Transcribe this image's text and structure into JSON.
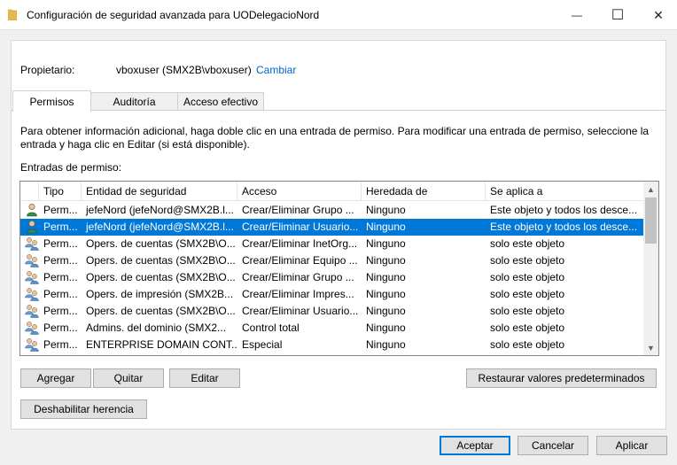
{
  "window": {
    "title": "Configuración de seguridad avanzada para UODelegacioNord",
    "minimize_glyph": "—",
    "maximize_glyph": "☐",
    "close_glyph": "✕",
    "folder_icon_color": "#e8b84a"
  },
  "owner": {
    "label": "Propietario:",
    "value": "vboxuser (SMX2B\\vboxuser)",
    "change_link": "Cambiar"
  },
  "tabs": [
    {
      "label": "Permisos",
      "active": true
    },
    {
      "label": "Auditoría",
      "active": false
    },
    {
      "label": "Acceso efectivo",
      "active": false
    }
  ],
  "info_text": "Para obtener información adicional, haga doble clic en una entrada de permiso. Para modificar una entrada de permiso, seleccione la entrada y haga clic en Editar (si está disponible).",
  "entries_label": "Entradas de permiso:",
  "columns": [
    "Tipo",
    "Entidad de seguridad",
    "Acceso",
    "Heredada de",
    "Se aplica a"
  ],
  "rows": [
    {
      "icon": "user-icon",
      "tipo": "Perm...",
      "entidad": "jefeNord (jefeNord@SMX2B.l...",
      "acceso": "Crear/Eliminar Grupo ...",
      "heredada": "Ninguno",
      "aplica": "Este objeto y todos los desce...",
      "selected": false
    },
    {
      "icon": "user-icon",
      "tipo": "Perm...",
      "entidad": "jefeNord (jefeNord@SMX2B.l...",
      "acceso": "Crear/Eliminar Usuario...",
      "heredada": "Ninguno",
      "aplica": "Este objeto y todos los desce...",
      "selected": true
    },
    {
      "icon": "group-icon",
      "tipo": "Perm...",
      "entidad": "Opers. de cuentas (SMX2B\\O...",
      "acceso": "Crear/Eliminar InetOrg...",
      "heredada": "Ninguno",
      "aplica": "solo este objeto",
      "selected": false
    },
    {
      "icon": "group-icon",
      "tipo": "Perm...",
      "entidad": "Opers. de cuentas (SMX2B\\O...",
      "acceso": "Crear/Eliminar Equipo ...",
      "heredada": "Ninguno",
      "aplica": "solo este objeto",
      "selected": false
    },
    {
      "icon": "group-icon",
      "tipo": "Perm...",
      "entidad": "Opers. de cuentas (SMX2B\\O...",
      "acceso": "Crear/Eliminar Grupo ...",
      "heredada": "Ninguno",
      "aplica": "solo este objeto",
      "selected": false
    },
    {
      "icon": "group-icon",
      "tipo": "Perm...",
      "entidad": "Opers. de impresión (SMX2B...",
      "acceso": "Crear/Eliminar Impres...",
      "heredada": "Ninguno",
      "aplica": "solo este objeto",
      "selected": false
    },
    {
      "icon": "group-icon",
      "tipo": "Perm...",
      "entidad": "Opers. de cuentas (SMX2B\\O...",
      "acceso": "Crear/Eliminar Usuario...",
      "heredada": "Ninguno",
      "aplica": "solo este objeto",
      "selected": false
    },
    {
      "icon": "group-icon",
      "tipo": "Perm...",
      "entidad": "Admins. del dominio (SMX2...",
      "acceso": "Control total",
      "heredada": "Ninguno",
      "aplica": "solo este objeto",
      "selected": false
    },
    {
      "icon": "group-icon",
      "tipo": "Perm...",
      "entidad": "ENTERPRISE DOMAIN CONT...",
      "acceso": "Especial",
      "heredada": "Ninguno",
      "aplica": "solo este objeto",
      "selected": false
    }
  ],
  "scrollbar": {
    "up_glyph": "▲",
    "down_glyph": "▼"
  },
  "buttons": {
    "agregar": "Agregar",
    "quitar": "Quitar",
    "editar": "Editar",
    "restaurar": "Restaurar valores predeterminados",
    "deshabilitar": "Deshabilitar herencia",
    "aceptar": "Aceptar",
    "cancelar": "Cancelar",
    "aplicar": "Aplicar"
  },
  "colors": {
    "selection": "#0078d7",
    "link": "#0066cc",
    "user_body": "#3a8a4a",
    "group_body": "#5b8fc9"
  }
}
